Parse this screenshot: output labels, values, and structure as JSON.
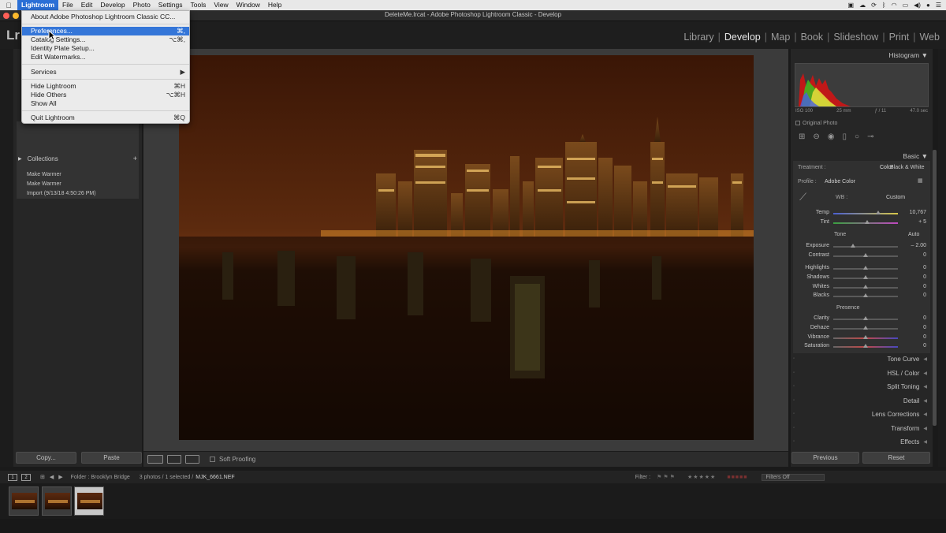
{
  "mac_menu": {
    "apple": "",
    "items": [
      "Lightroom",
      "File",
      "Edit",
      "Develop",
      "Photo",
      "Settings",
      "Tools",
      "View",
      "Window",
      "Help"
    ],
    "active": "Lightroom"
  },
  "window": {
    "title": "DeleteMe.lrcat - Adobe Photoshop Lightroom Classic - Develop"
  },
  "logo": "Lr",
  "modules": [
    "Library",
    "Develop",
    "Map",
    "Book",
    "Slideshow",
    "Print",
    "Web"
  ],
  "active_module": "Develop",
  "app_menu": {
    "items": [
      {
        "label": "About Adobe Photoshop Lightroom Classic CC...",
        "shortcut": ""
      },
      {
        "label": "Preferences...",
        "shortcut": "⌘,",
        "highlighted": true
      },
      {
        "label": "Catalog Settings...",
        "shortcut": "⌥⌘,"
      },
      {
        "label": "Identity Plate Setup...",
        "shortcut": ""
      },
      {
        "label": "Edit Watermarks...",
        "shortcut": ""
      },
      {
        "label": "Services",
        "shortcut": "▶"
      },
      {
        "label": "Hide Lightroom",
        "shortcut": "⌘H"
      },
      {
        "label": "Hide Others",
        "shortcut": "⌥⌘H"
      },
      {
        "label": "Show All",
        "shortcut": ""
      },
      {
        "label": "Quit Lightroom",
        "shortcut": "⌘Q"
      }
    ]
  },
  "history": [
    "Make Warmer",
    "Make Warmer",
    "Import (9/13/18 4:50:26 PM)"
  ],
  "collections_label": "Collections",
  "left_buttons": {
    "copy": "Copy...",
    "paste": "Paste"
  },
  "toolbar": {
    "soft_proofing": "Soft Proofing"
  },
  "right_panel": {
    "histogram_label": "Histogram",
    "iso": "ISO 100",
    "focal": "25 mm",
    "aperture": "ƒ / 11",
    "shutter": "47.0 sec",
    "original_photo": "Original Photo",
    "basic_label": "Basic",
    "treatment_label": "Treatment :",
    "treatment_color": "Color",
    "treatment_bw": "Black & White",
    "profile_label": "Profile :",
    "profile_value": "Adobe Color",
    "wb_label": "WB :",
    "wb_value": "Custom",
    "tone_label": "Tone",
    "auto_label": "Auto",
    "presence_label": "Presence",
    "sliders": [
      {
        "name": "Temp",
        "value": "10,767",
        "pos": 0.7
      },
      {
        "name": "Tint",
        "value": "+ 5",
        "pos": 0.52
      },
      {
        "name": "Exposure",
        "value": "– 2.00",
        "pos": 0.3
      },
      {
        "name": "Contrast",
        "value": "0",
        "pos": 0.5
      },
      {
        "name": "Highlights",
        "value": "0",
        "pos": 0.5
      },
      {
        "name": "Shadows",
        "value": "0",
        "pos": 0.5
      },
      {
        "name": "Whites",
        "value": "0",
        "pos": 0.5
      },
      {
        "name": "Blacks",
        "value": "0",
        "pos": 0.5
      },
      {
        "name": "Clarity",
        "value": "0",
        "pos": 0.5
      },
      {
        "name": "Dehaze",
        "value": "0",
        "pos": 0.5
      },
      {
        "name": "Vibrance",
        "value": "0",
        "pos": 0.5
      },
      {
        "name": "Saturation",
        "value": "0",
        "pos": 0.5
      }
    ],
    "sections": [
      "Tone Curve",
      "HSL / Color",
      "Split Toning",
      "Detail",
      "Lens Corrections",
      "Transform",
      "Effects"
    ],
    "previous": "Previous",
    "reset": "Reset"
  },
  "filmbar": {
    "page1": "1",
    "page2": "2",
    "folder": "Folder : Brooklyn Bridge",
    "count": "3 photos / 1 selected /",
    "filename": "MJK_6661.NEF",
    "filter_label": "Filter :",
    "filters_off": "Filters Off"
  }
}
